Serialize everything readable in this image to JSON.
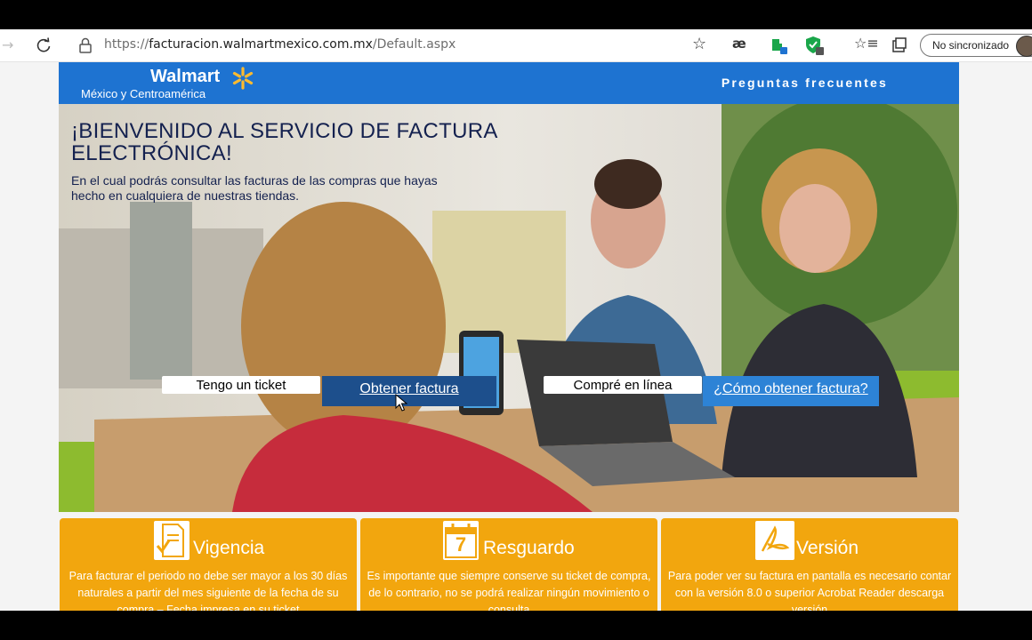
{
  "browser": {
    "url_prefix": "https://",
    "url_host": "facturacion.walmartmexico.com.mx",
    "url_path": "/Default.aspx",
    "sync_label": "No sincronizado",
    "colors": {
      "shield_badge": "#1aa64a",
      "ext_badge": "#1e73d1"
    }
  },
  "header": {
    "logo_main": "Walmart",
    "logo_sub": "México y Centroamérica",
    "faq_link": "Preguntas frecuentes",
    "color": "#1e73d1"
  },
  "hero": {
    "title": "¡BIENVENIDO AL SERVICIO DE FACTURA ELECTRÓNICA!",
    "intro": "En el cual podrás consultar las facturas de las compras que hayas hecho en cualquiera de nuestras tiendas.",
    "ticket_label": "Tengo un ticket",
    "ticket_button": "Obtener factura",
    "online_label": "Compré en línea",
    "online_button": "¿Cómo obtener factura?"
  },
  "cards": [
    {
      "title": "Vigencia",
      "icon": "document-check-icon",
      "text": "Para facturar el periodo no debe ser mayor a los 30 días naturales a partir del mes siguiente de la fecha de su compra – Fecha impresa en su ticket"
    },
    {
      "title": "Resguardo",
      "icon": "calendar-7-icon",
      "icon_text": "7",
      "text": "Es importante que siempre conserve su ticket de compra, de lo contrario, no se podrá realizar ningún movimiento o consulta"
    },
    {
      "title": "Versión",
      "icon": "acrobat-icon",
      "text": "Para poder ver su factura en pantalla es necesario contar con la versión 8.0 o superior Acrobat Reader descarga versión"
    }
  ],
  "colors": {
    "card": "#f2a60e",
    "dark_button": "#1d4f8c",
    "blue_button": "#2d83d6",
    "title": "#14214f"
  }
}
